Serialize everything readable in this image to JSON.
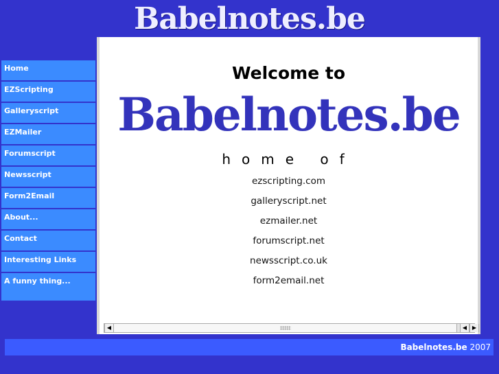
{
  "header": {
    "logo_text": "Babelnotes.be"
  },
  "sidebar": {
    "items": [
      {
        "label": "Home"
      },
      {
        "label": "EZScripting"
      },
      {
        "label": "Galleryscript"
      },
      {
        "label": "EZMailer"
      },
      {
        "label": "Forumscript"
      },
      {
        "label": "Newsscript"
      },
      {
        "label": "Form2Email"
      },
      {
        "label": "About..."
      },
      {
        "label": "Contact"
      },
      {
        "label": "Interesting Links"
      },
      {
        "label": "A funny thing..."
      }
    ]
  },
  "main": {
    "welcome": "Welcome to",
    "logo_text": "Babelnotes.be",
    "home_of": "home of",
    "domains": [
      "ezscripting.com",
      "galleryscript.net",
      "ezmailer.net",
      "forumscript.net",
      "newsscript.co.uk",
      "form2email.net"
    ]
  },
  "footer": {
    "site": "Babelnotes.be",
    "year": "2007"
  },
  "colors": {
    "background": "#3333cc",
    "nav": "#3b8bff",
    "footer": "#3b5bff",
    "logo": "#3333bb"
  },
  "icons": {
    "scroll_left": "arrow-left-icon",
    "scroll_right": "arrow-right-icon",
    "grip": "grip-icon"
  }
}
